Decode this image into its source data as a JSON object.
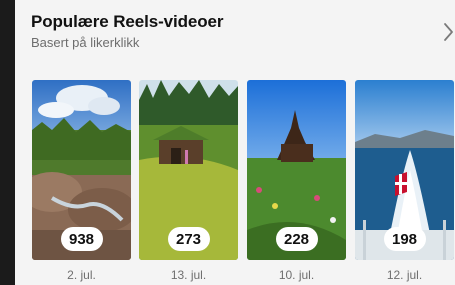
{
  "section": {
    "title": "Populære Reels-videoer",
    "subtitle": "Basert på likerklikk"
  },
  "icons": {
    "next": "chevron-right-icon"
  },
  "reels": [
    {
      "likes": "938",
      "date": "2. jul.",
      "scene": "forest-creek"
    },
    {
      "likes": "273",
      "date": "13. jul.",
      "scene": "turf-roof-cabin"
    },
    {
      "likes": "228",
      "date": "10. jul.",
      "scene": "stave-church-meadow"
    },
    {
      "likes": "198",
      "date": "12. jul.",
      "scene": "ferry-wake-flag"
    }
  ]
}
